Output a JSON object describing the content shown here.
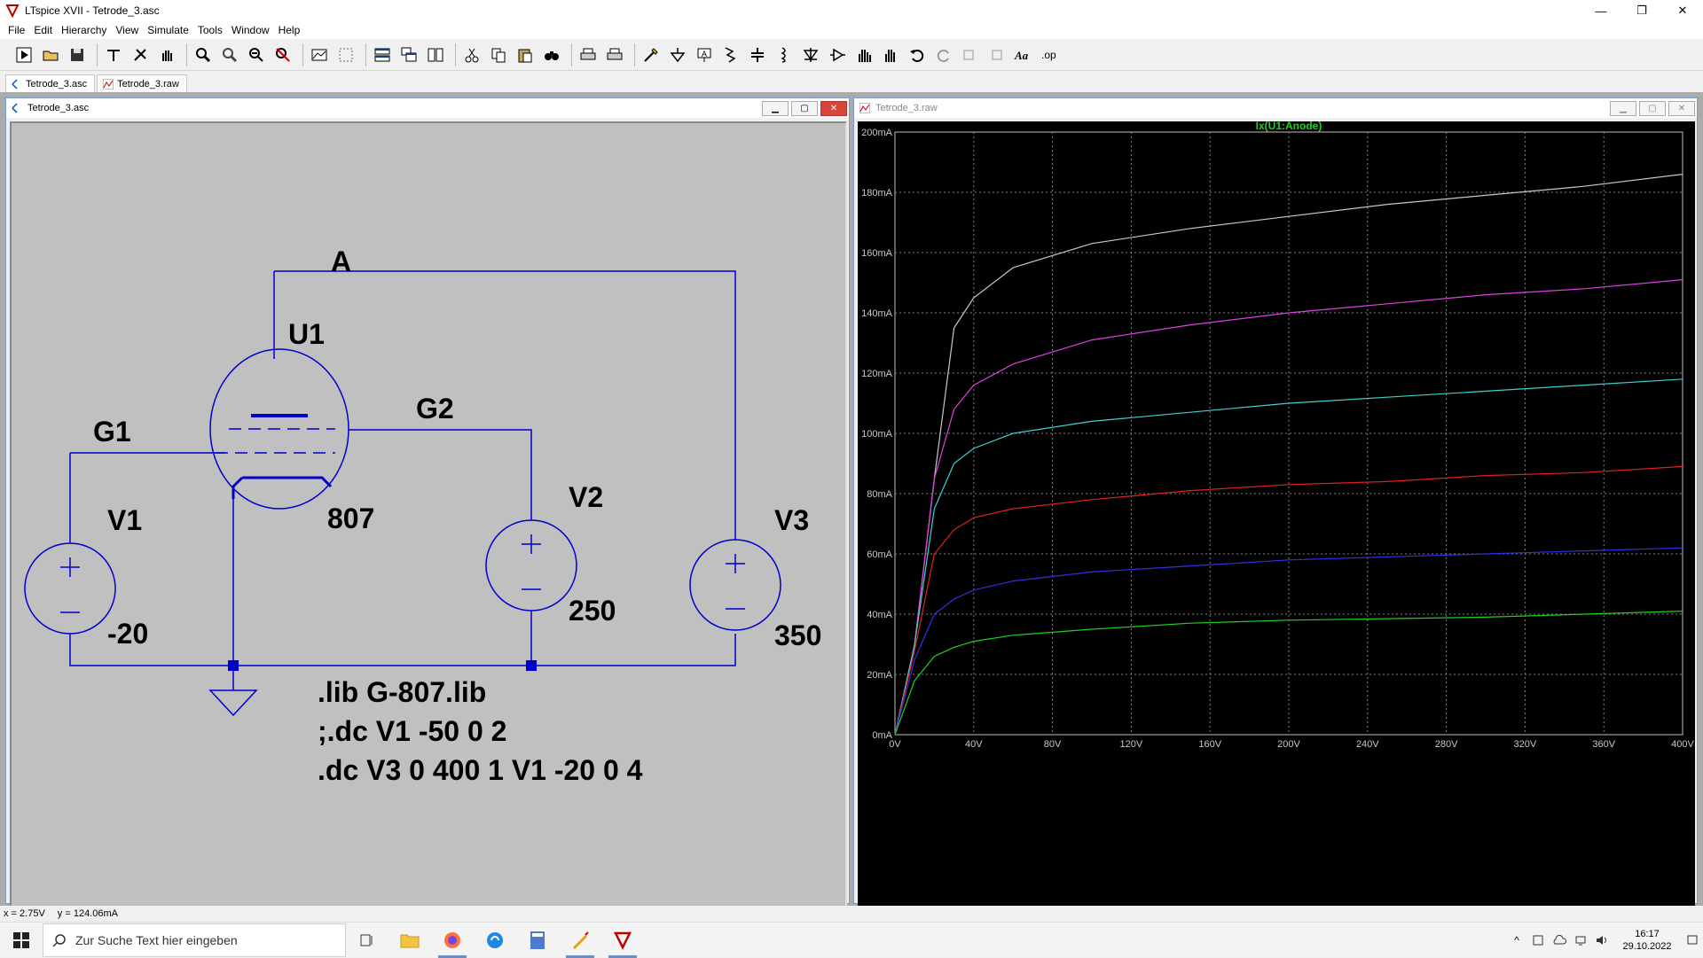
{
  "app": {
    "window_title": "LTspice XVII - Tetrode_3.asc",
    "controls": [
      "—",
      "❐",
      "✕"
    ]
  },
  "menu": [
    "File",
    "Edit",
    "Hierarchy",
    "View",
    "Simulate",
    "Tools",
    "Window",
    "Help"
  ],
  "toolbar_icons": [
    "run-icon",
    "open-icon",
    "save-icon",
    "control-panel-icon",
    "halt-icon",
    "pan-icon",
    "zoom-in-icon",
    "zoom-area-icon",
    "zoom-out-icon",
    "zoom-cancel-icon",
    "autorange-icon",
    "fit-icon",
    "tile-horizontal-icon",
    "cascade-icon",
    "tile-vertical-icon",
    "cut-icon",
    "copy-icon",
    "paste-icon",
    "find-icon",
    "print-icon",
    "print-preview-icon",
    "wire-icon",
    "ground-icon",
    "label-net-icon",
    "resistor-icon",
    "capacitor-icon",
    "inductor-icon",
    "diode-icon",
    "component-icon",
    "move-icon",
    "drag-icon",
    "undo-icon",
    "redo-icon",
    "rotate-icon",
    "mirror-icon",
    "text-icon",
    "spice-directive-icon"
  ],
  "tabs": [
    {
      "label": "Tetrode_3.asc",
      "icon": "schematic-icon"
    },
    {
      "label": "Tetrode_3.raw",
      "icon": "waveform-icon"
    }
  ],
  "schematic": {
    "title": "Tetrode_3.asc",
    "labels": {
      "anode_net": "A",
      "tube_ref": "U1",
      "tube_model": "807",
      "g1_net": "G1",
      "g2_net": "G2",
      "v1_ref": "V1",
      "v1_value": "-20",
      "v2_ref": "V2",
      "v2_value": "250",
      "v3_ref": "V3",
      "v3_value": "350"
    },
    "directives": [
      ".lib G-807.lib",
      ";.dc V1 -50 0 2",
      ".dc V3 0 400 1 V1 -20 0 4"
    ],
    "colors": {
      "wire": "#0000cc",
      "symbol": "#0000cc",
      "background": "#c0c0c0"
    }
  },
  "waveform": {
    "title": "Tetrode_3.raw"
  },
  "chart_data": {
    "type": "line",
    "title": "Ix(U1:Anode)",
    "xlabel": "",
    "ylabel": "",
    "xlim": [
      0,
      400
    ],
    "ylim": [
      0,
      200
    ],
    "x_ticks": [
      "0V",
      "40V",
      "80V",
      "120V",
      "160V",
      "200V",
      "240V",
      "280V",
      "320V",
      "360V",
      "400V"
    ],
    "y_ticks": [
      "0mA",
      "20mA",
      "40mA",
      "60mA",
      "80mA",
      "100mA",
      "120mA",
      "140mA",
      "160mA",
      "180mA",
      "200mA"
    ],
    "grid": true,
    "x": [
      0,
      10,
      20,
      30,
      40,
      60,
      100,
      150,
      200,
      250,
      300,
      350,
      400
    ],
    "series": [
      {
        "color": "#c8c8c8",
        "values": [
          0,
          30,
          85,
          135,
          145,
          155,
          163,
          168,
          172,
          176,
          179,
          182,
          186
        ]
      },
      {
        "color": "#e040e0",
        "values": [
          0,
          30,
          85,
          108,
          116,
          123,
          131,
          136,
          140,
          143,
          146,
          148,
          151
        ]
      },
      {
        "color": "#40d0d0",
        "values": [
          0,
          30,
          75,
          90,
          95,
          100,
          104,
          107,
          110,
          112,
          114,
          116,
          118
        ]
      },
      {
        "color": "#e02020",
        "values": [
          0,
          28,
          60,
          68,
          72,
          75,
          78,
          81,
          83,
          84,
          86,
          87,
          89
        ]
      },
      {
        "color": "#3030e0",
        "values": [
          0,
          25,
          40,
          45,
          48,
          51,
          54,
          56,
          58,
          59,
          60,
          61,
          62
        ]
      },
      {
        "color": "#20d020",
        "values": [
          0,
          18,
          26,
          29,
          31,
          33,
          35,
          37,
          38,
          38.5,
          39,
          40,
          41
        ]
      }
    ]
  },
  "status": {
    "x": "x = 2.75V",
    "y": "y = 124.06mA"
  },
  "taskbar": {
    "search_placeholder": "Zur Suche Text hier eingeben",
    "apps": [
      "task-view-icon",
      "file-explorer-icon",
      "firefox-icon",
      "app-icon",
      "calculator-icon",
      "pen-app-icon",
      "ltspice-icon"
    ],
    "time": "16:17",
    "date": "29.10.2022"
  }
}
